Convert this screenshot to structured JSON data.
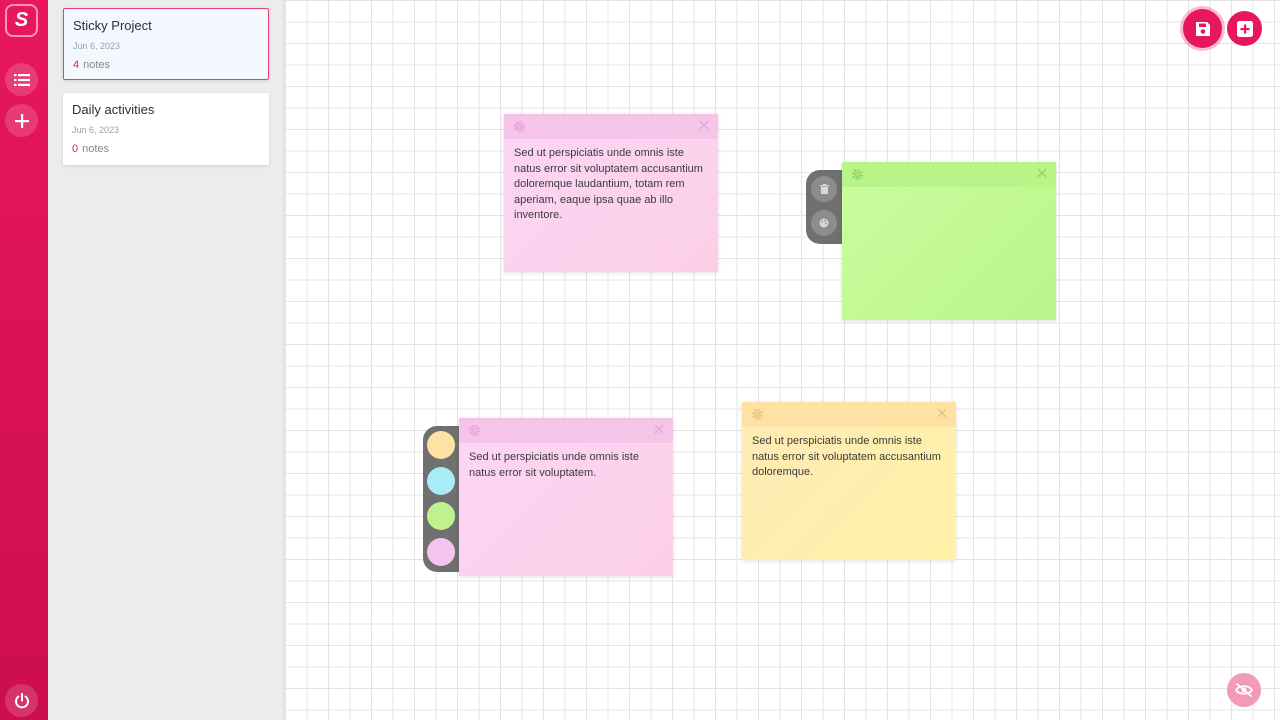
{
  "app": {
    "logo_letter": "S"
  },
  "projects": [
    {
      "name": "Sticky Project",
      "date": "Jun 6, 2023",
      "count": "4",
      "count_label": "notes"
    },
    {
      "name": "Daily activities",
      "date": "Jun 6, 2023",
      "count": "0",
      "count_label": "notes"
    }
  ],
  "notes": [
    {
      "color": "pink",
      "text": "Sed ut perspiciatis unde omnis iste natus error sit voluptatem accusantium doloremque laudantium, totam rem aperiam, eaque ipsa quae ab illo inventore."
    },
    {
      "color": "green",
      "text": ""
    },
    {
      "color": "pink",
      "text": "Sed ut perspiciatis unde omnis iste natus error sit voluptatem."
    },
    {
      "color": "yellow",
      "text": "Sed ut perspiciatis unde omnis iste natus error sit voluptatem accusantium doloremque."
    }
  ],
  "palette": [
    "#fde2a4",
    "#a8ecf5",
    "#bff28f",
    "#f5c4ee"
  ],
  "colors": {
    "accent": "#e8175d",
    "panel": "#ececec",
    "menu": "#707070"
  }
}
